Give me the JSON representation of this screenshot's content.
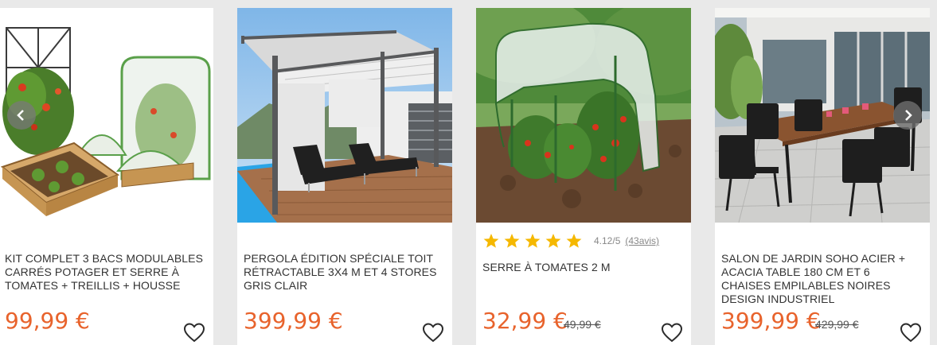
{
  "carousel": {
    "products": [
      {
        "title": "KIT COMPLET 3 BACS MODULABLES CARRÉS POTAGER ET SERRE À TOMATES + TREILLIS + HOUSSE",
        "price": "99,99 €"
      },
      {
        "title": "PERGOLA ÉDITION SPÉCIALE TOIT RÉTRACTABLE 3X4 M ET 4 STORES GRIS CLAIR",
        "price": "399,99 €"
      },
      {
        "title": "SERRE À TOMATES 2 M",
        "price": "32,99 €",
        "old_price": "49,99 €",
        "rating": {
          "score": "4.12/5",
          "count": "(43avis)",
          "stars": 5
        }
      },
      {
        "title": "SALON DE JARDIN SOHO ACIER + ACACIA TABLE 180 CM ET 6 CHAISES EMPILABLES NOIRES DESIGN INDUSTRIEL",
        "price": "399,99 €",
        "old_price": "429,99 €"
      }
    ],
    "icons": {
      "prev": "chevron-left-icon",
      "next": "chevron-right-icon",
      "wishlist": "heart-outline-icon",
      "star": "star-icon"
    },
    "colors": {
      "price": "#e8632c",
      "star": "#f5b800",
      "background": "#e9e9e9"
    }
  }
}
